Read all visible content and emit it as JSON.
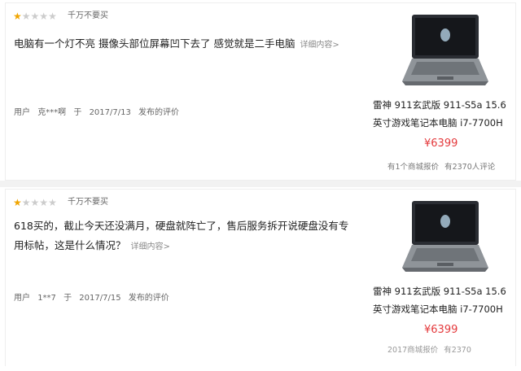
{
  "reviews": [
    {
      "stars": 1,
      "rating_text": "千万不要买",
      "content": "电脑有一个灯不亮 摄像头部位屏幕凹下去了 感觉就是二手电脑",
      "more": "详细内容>",
      "user_prefix": "用户",
      "user": "克***啊",
      "at": "于",
      "date": "2017/7/13",
      "posted": "发布的评价",
      "product_line1": "雷神 911玄武版 911-S5a 15.6",
      "product_line2": "英寸游戏笔记本电脑 i7-7700H",
      "price": "¥6399",
      "stat1": "有1个商城报价",
      "stat2": "有2370人评论"
    },
    {
      "stars": 1,
      "rating_text": "千万不要买",
      "content": "618买的，截止今天还没满月，硬盘就阵亡了，售后服务拆开说硬盘没有专用标帖，这是什么情况？",
      "more": "详细内容>",
      "user_prefix": "用户",
      "user": "1**7",
      "at": "于",
      "date": "2017/7/15",
      "posted": "发布的评价",
      "product_line1": "雷神 911玄武版 911-S5a 15.6",
      "product_line2": "英寸游戏笔记本电脑 i7-7700H",
      "price": "¥6399",
      "stat1": "2017商城报价",
      "stat2": "有2370"
    }
  ],
  "colors": {
    "price": "#e4393c",
    "star_on": "#f0a500",
    "star_off": "#cccccc"
  },
  "icons": {
    "star": "star-icon",
    "laptop": "laptop-image"
  }
}
